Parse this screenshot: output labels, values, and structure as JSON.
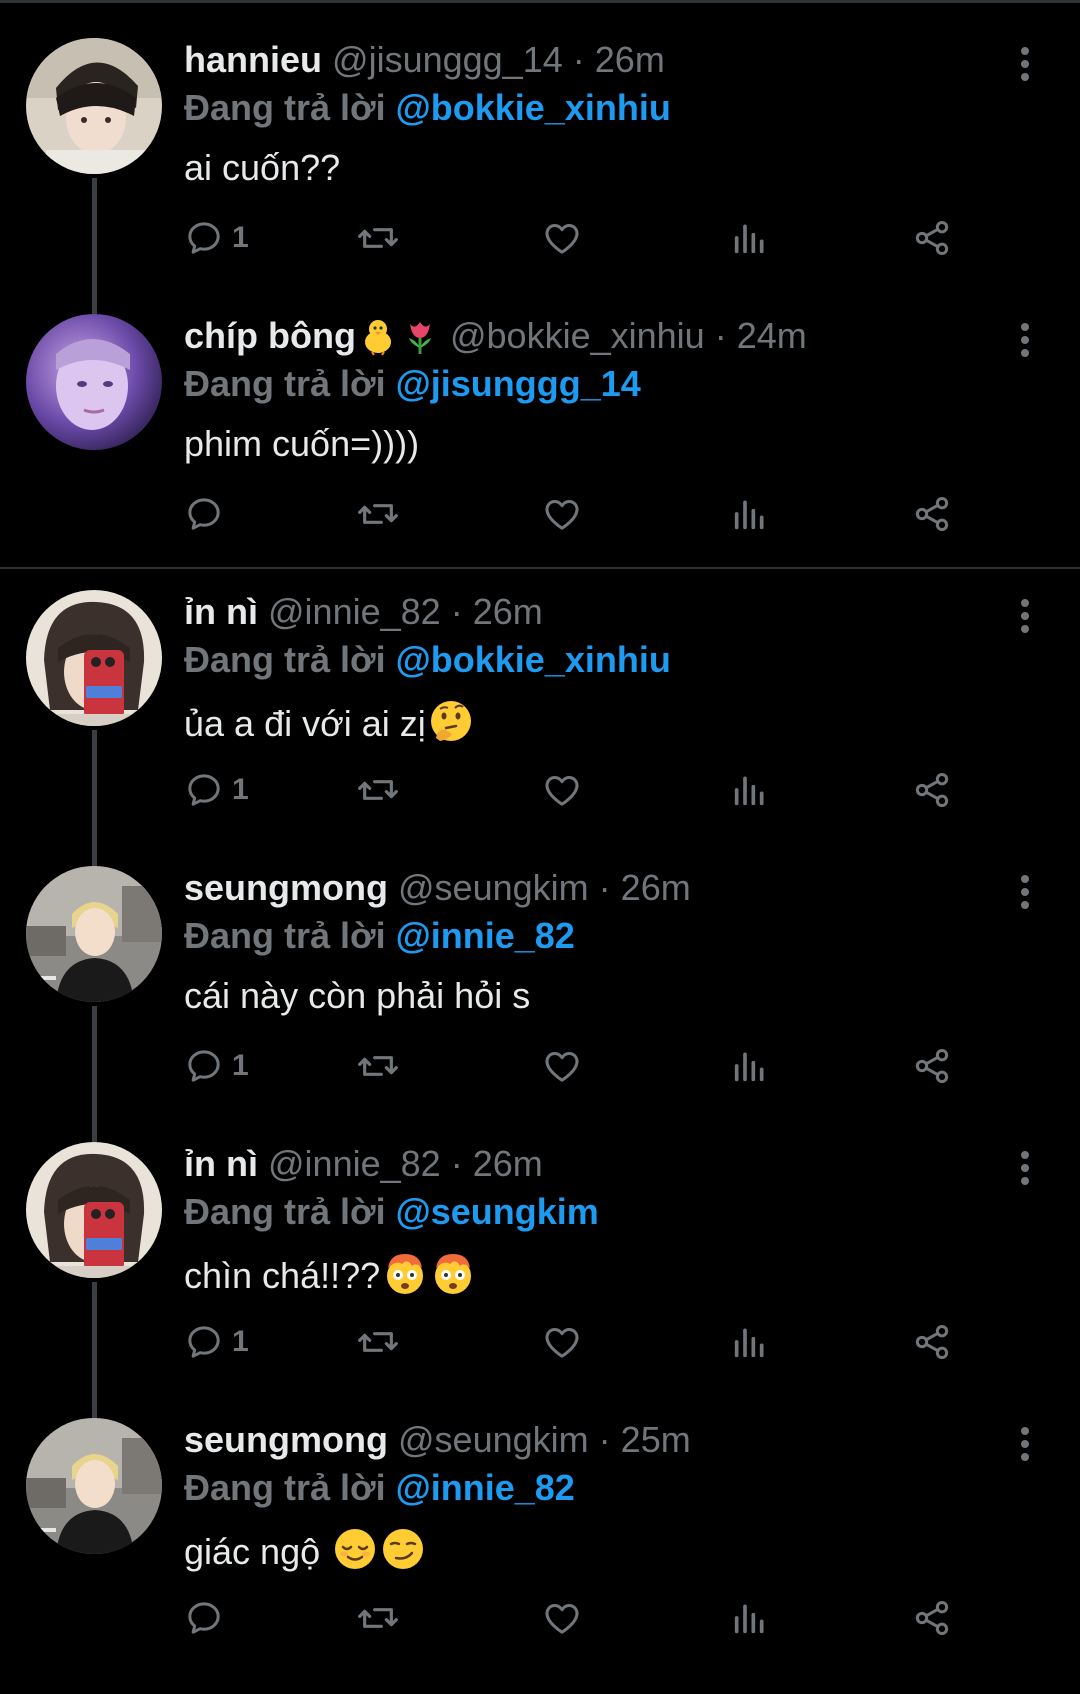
{
  "reply_label": "Đang trả lời",
  "colors": {
    "background": "#000000",
    "text": "#e7e9ea",
    "muted": "#71767b",
    "accent": "#1d9bf0",
    "divider": "#2f3336"
  },
  "tweets": [
    {
      "name": "hannieu",
      "handle": "@jisunggg_14",
      "time": "26m",
      "reply_to": "@bokkie_xinhiu",
      "text": "ai cuốn??",
      "reply_count": "1",
      "avatar_icon": "avatar-hannieu"
    },
    {
      "name": "chíp bông",
      "name_emojis": [
        "chick-emoji",
        "tulip-emoji"
      ],
      "handle": "@bokkie_xinhiu",
      "time": "24m",
      "reply_to": "@jisunggg_14",
      "text": "phim cuốn=))))",
      "reply_count": "",
      "avatar_icon": "avatar-chip-bong"
    },
    {
      "name": "ỉn nì",
      "handle": "@innie_82",
      "time": "26m",
      "reply_to": "@bokkie_xinhiu",
      "text": "ủa a đi với ai zị",
      "text_emojis": [
        "thinking-face-emoji"
      ],
      "reply_count": "1",
      "avatar_icon": "avatar-in-ni"
    },
    {
      "name": "seungmong",
      "handle": "@seungkim",
      "time": "26m",
      "reply_to": "@innie_82",
      "text": "cái này còn phải hỏi s",
      "reply_count": "1",
      "avatar_icon": "avatar-seungmong"
    },
    {
      "name": "ỉn nì",
      "handle": "@innie_82",
      "time": "26m",
      "reply_to": "@seungkim",
      "text": "chìn chá!!??",
      "text_emojis": [
        "exploding-head-emoji",
        "exploding-head-emoji"
      ],
      "reply_count": "1",
      "avatar_icon": "avatar-in-ni"
    },
    {
      "name": "seungmong",
      "handle": "@seungkim",
      "time": "25m",
      "reply_to": "@innie_82",
      "text": "giác ngộ",
      "text_emojis": [
        "relieved-face-emoji",
        "smirking-face-emoji"
      ],
      "reply_count": "",
      "avatar_icon": "avatar-seungmong"
    }
  ]
}
